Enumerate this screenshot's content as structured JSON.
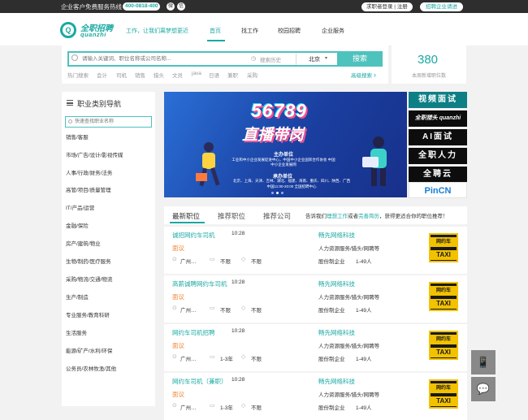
{
  "topbar": {
    "hotline_label": "企业客户免费服务热线",
    "hotline_number": "400-0818-400",
    "login_register": "求职者登录 | 注册",
    "recruiter_pill": "招聘企业请进"
  },
  "header": {
    "logo_cn": "全职招聘",
    "logo_en": "quanzhi",
    "slogan": "工作，让我们离梦想更近",
    "nav": [
      "首页",
      "找工作",
      "校园招聘",
      "企业服务"
    ]
  },
  "search": {
    "placeholder": "请输入关键词、职位名称或公司名称...",
    "history_label": "搜索历史",
    "city": "北京",
    "button": "搜索",
    "hot_label": "热门搜索",
    "hot_terms": [
      "会计",
      "司机",
      "销售",
      "猎头",
      "文员",
      "java",
      "日语",
      "兼职",
      "采购"
    ],
    "advanced": "高级搜索"
  },
  "stats": {
    "count": "380",
    "label": "本周新增职位数"
  },
  "categories": {
    "title": "职业类别导航",
    "search_placeholder": "快速查找职业名称",
    "items": [
      "销售/客服",
      "市场/广告/设计/影视传媒",
      "人事/行政/财务/法务",
      "高管/项目/质量管理",
      "IT/产品/运营",
      "金融/保险",
      "房产/建筑/物业",
      "生物/制药/医疗服务",
      "采购/物流/交通/物流",
      "生产/制造",
      "专业服务/教育科研",
      "生活服务",
      "能源/矿产/水利/环保",
      "公务员/农林牧渔/其他"
    ]
  },
  "banner": {
    "title": "56789",
    "subtitle": "直播带岗",
    "host_label": "主办单位",
    "host_orgs": "工业和中小企业发展促进中心，中国中小企业国际合作协会 中国中小企业发展网",
    "co_label": "承办单位",
    "cities": "北京、上海、天津、吉林、湖北、福建、海南、重庆、四川、陕西、广西",
    "time": "中国11:00-20:00 全国招聘中心"
  },
  "side_ads": [
    "视频面试",
    "全职猎头 quanzhi",
    "AI面试",
    "全职人力",
    "全聘云",
    "PinCN"
  ],
  "tabs": {
    "items": [
      "最新职位",
      "推荐职位",
      "推荐公司"
    ],
    "tip_prefix": "告诉我们",
    "tip_link1": "理想工作",
    "tip_mid": "或者",
    "tip_link2": "完善简历",
    "tip_suffix": "，获得更适合你的职位推荐！"
  },
  "jobs": [
    {
      "title": "诚招网约车司机",
      "time": "10:28",
      "salary": "面议",
      "location": "广州…",
      "experience": "不限",
      "education": "不限",
      "company": "畅先网络科技",
      "industry": "人力资源服务/猎头/网聘等",
      "type": "股份制企业",
      "size": "1-49人",
      "logo_top": "网约车",
      "logo_bot": "TAXI"
    },
    {
      "title": "高薪诚聘网约车司机",
      "time": "10:28",
      "salary": "面议",
      "location": "广州…",
      "experience": "不限",
      "education": "不限",
      "company": "畅先网络科技",
      "industry": "人力资源服务/猎头/网聘等",
      "type": "股份制企业",
      "size": "1-49人",
      "logo_top": "网约车",
      "logo_bot": "TAXI"
    },
    {
      "title": "网约车司机招聘",
      "time": "10:28",
      "salary": "面议",
      "location": "广州…",
      "experience": "1-3年",
      "education": "不限",
      "company": "畅先网络科技",
      "industry": "人力资源服务/猎头/网聘等",
      "type": "股份制企业",
      "size": "1-49人",
      "logo_top": "网约车",
      "logo_bot": "TAXI"
    },
    {
      "title": "网约车司机（兼职）",
      "time": "10:28",
      "salary": "面议",
      "location": "广州…",
      "experience": "1-3年",
      "education": "不限",
      "company": "畅先网络科技",
      "industry": "人力资源服务/猎头/网聘等",
      "type": "股份制企业",
      "size": "1-49人",
      "logo_top": "网约车",
      "logo_bot": "TAXI"
    }
  ],
  "colors": {
    "accent": "#1aa9a3",
    "search_border": "#4ec2bd",
    "salary": "#f08a3a",
    "topbar": "#2e2e2e"
  },
  "icons": [
    "search-icon",
    "clock-icon",
    "weibo-icon",
    "wechat-icon",
    "menu-icon",
    "location-icon",
    "briefcase-icon",
    "graduation-icon",
    "phone-icon",
    "chevron-right-icon"
  ]
}
